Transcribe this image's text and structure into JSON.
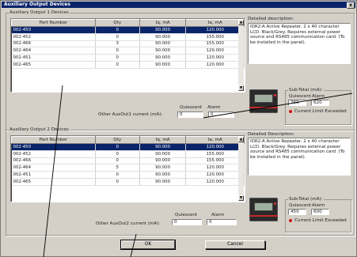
{
  "window": {
    "title": "Auxiliary Output Devices",
    "close_glyph": "x"
  },
  "columns": [
    "Part Number",
    "Qty",
    "Iq, mA",
    "Ia, mA"
  ],
  "group1": {
    "title": "Auxiliary Output 1 Devices",
    "rows": [
      {
        "part": "002-450",
        "qty": "0",
        "iq": "90.000",
        "ia": "120.000",
        "selected": true
      },
      {
        "part": "002-452",
        "qty": "0",
        "iq": "90.000",
        "ia": "155.000"
      },
      {
        "part": "002-466",
        "qty": "3",
        "iq": "90.000",
        "ia": "155.000"
      },
      {
        "part": "002-464",
        "qty": "0",
        "iq": "90.000",
        "ia": "120.000"
      },
      {
        "part": "002-451",
        "qty": "0",
        "iq": "90.000",
        "ia": "120.000"
      },
      {
        "part": "002-465",
        "qty": "0",
        "iq": "90.000",
        "ia": "120.000"
      }
    ],
    "description_label": "Detailed description:",
    "description": "IDR2-A Active Repeater. 2 x 40 character LCD. Black/Grey. Requires external power source and RS485 communication card. (To be installed in the panel).",
    "other_label": "Other AuxOut1 current (mA):",
    "quiescent_label": "Quiescent",
    "alarm_label": "Alarm",
    "quiescent_value": "0",
    "alarm_value": "0",
    "subtotal_label": "Sub-Total (mA):",
    "subtotal_quiescent_label": "Quiescent",
    "subtotal_alarm_label": "Alarm",
    "subtotal_quiescent": "360",
    "subtotal_alarm": "620",
    "limit_label": "Current Limit Exceeded"
  },
  "group2": {
    "title": "Auxiliary Output 2 Devices",
    "rows": [
      {
        "part": "002-450",
        "qty": "0",
        "iq": "90.000",
        "ia": "120.000",
        "selected": true
      },
      {
        "part": "002-452",
        "qty": "0",
        "iq": "90.000",
        "ia": "155.000"
      },
      {
        "part": "002-466",
        "qty": "0",
        "iq": "90.000",
        "ia": "155.000"
      },
      {
        "part": "002-464",
        "qty": "5",
        "iq": "90.000",
        "ia": "120.000"
      },
      {
        "part": "002-451",
        "qty": "0",
        "iq": "90.000",
        "ia": "120.000"
      },
      {
        "part": "002-465",
        "qty": "0",
        "iq": "90.000",
        "ia": "120.000"
      }
    ],
    "description_label": "Detailed Description:",
    "description": "IDR2-A Active Repeater. 2 x 40 character LCD. Black/Grey. Requires external power source and RS485 communication card. (To be installed in the panel).",
    "other_label": "Other AuxOut2 current (mA):",
    "quiescent_label": "Quiescent",
    "alarm_label": "Alarm",
    "quiescent_value": "0",
    "alarm_value": "0",
    "subtotal_label": "Sub-Total (mA):",
    "subtotal_quiescent_label": "Quiescent",
    "subtotal_alarm_label": "Alarm",
    "subtotal_quiescent": "450",
    "subtotal_alarm": "600",
    "limit_label": "Current Limit Exceeded"
  },
  "buttons": {
    "ok": "OK",
    "cancel": "Cancel"
  },
  "scroll_glyphs": {
    "up": "▲",
    "down": "▼"
  }
}
